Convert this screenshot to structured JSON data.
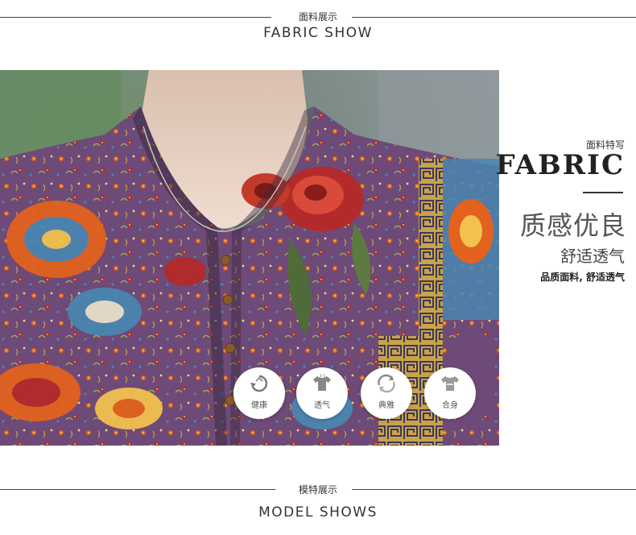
{
  "header_top": {
    "cn": "面料展示",
    "en": "FABRIC SHOW"
  },
  "fabric_panel": {
    "small_label": "面料特写",
    "big_label": "FABRIC",
    "title": "质感优良",
    "subtitle": "舒适透气",
    "description": "品质面料, 舒适透气"
  },
  "badges": [
    {
      "label": "健康",
      "icon": "recycle-icon"
    },
    {
      "label": "透气",
      "icon": "shirt-icon"
    },
    {
      "label": "典雅",
      "icon": "swirl-icon"
    },
    {
      "label": "合身",
      "icon": "fit-shirt-icon"
    }
  ],
  "header_bottom": {
    "cn": "模特展示",
    "en": "MODEL SHOWS"
  },
  "colors": {
    "fabric_purple": "#6e4a78",
    "fabric_orange": "#e2621e",
    "fabric_red": "#b32a2a",
    "fabric_blue": "#4a86b0",
    "skin": "#ecd5c6",
    "background_gray": "#7d8a86"
  }
}
